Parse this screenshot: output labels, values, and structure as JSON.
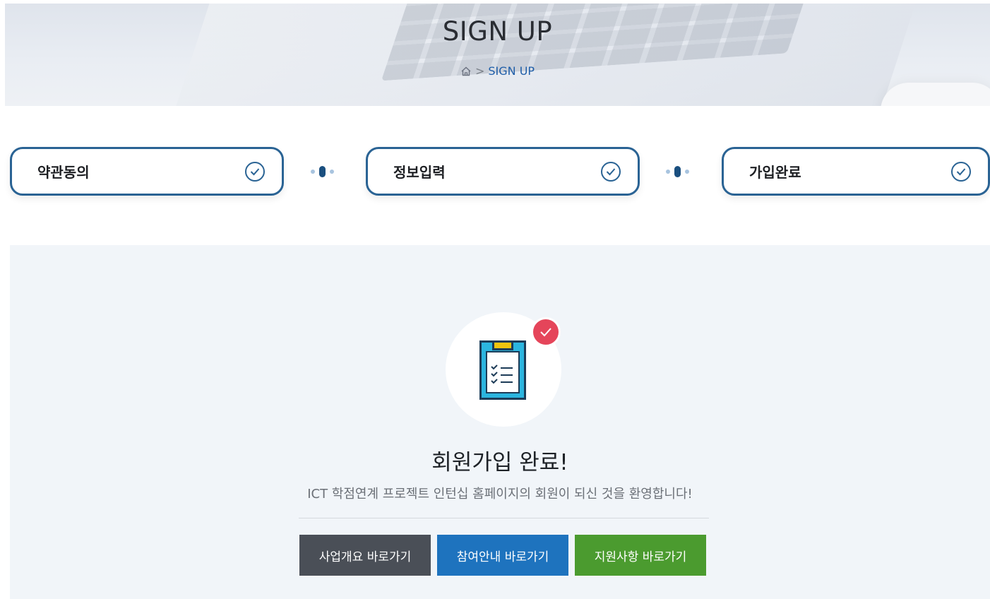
{
  "header": {
    "title": "SIGN UP",
    "breadcrumb": {
      "home_icon": "home-icon",
      "separator": ">",
      "current": "SIGN UP"
    }
  },
  "steps": [
    {
      "label": "약관동의",
      "icon": "check-circle-icon"
    },
    {
      "label": "정보입력",
      "icon": "check-circle-icon"
    },
    {
      "label": "가입완료",
      "icon": "check-circle-icon"
    }
  ],
  "complete": {
    "illustration": "clipboard-checklist-icon",
    "badge_icon": "check-icon",
    "title": "회원가입 완료!",
    "message": "ICT 학점연계 프로젝트 인턴십 홈페이지의 회원이 되신 것을 환영합니다!"
  },
  "buttons": [
    {
      "label": "사업개요 바로가기",
      "color": "#4a4f57"
    },
    {
      "label": "참여안내 바로가기",
      "color": "#1e73be"
    },
    {
      "label": "지원사항 바로가기",
      "color": "#4b9b2f"
    }
  ],
  "colors": {
    "step_border": "#2a6394",
    "breadcrumb_current": "#1f5ea8",
    "badge": "#e5455a",
    "panel_bg": "#f1f5f9"
  }
}
